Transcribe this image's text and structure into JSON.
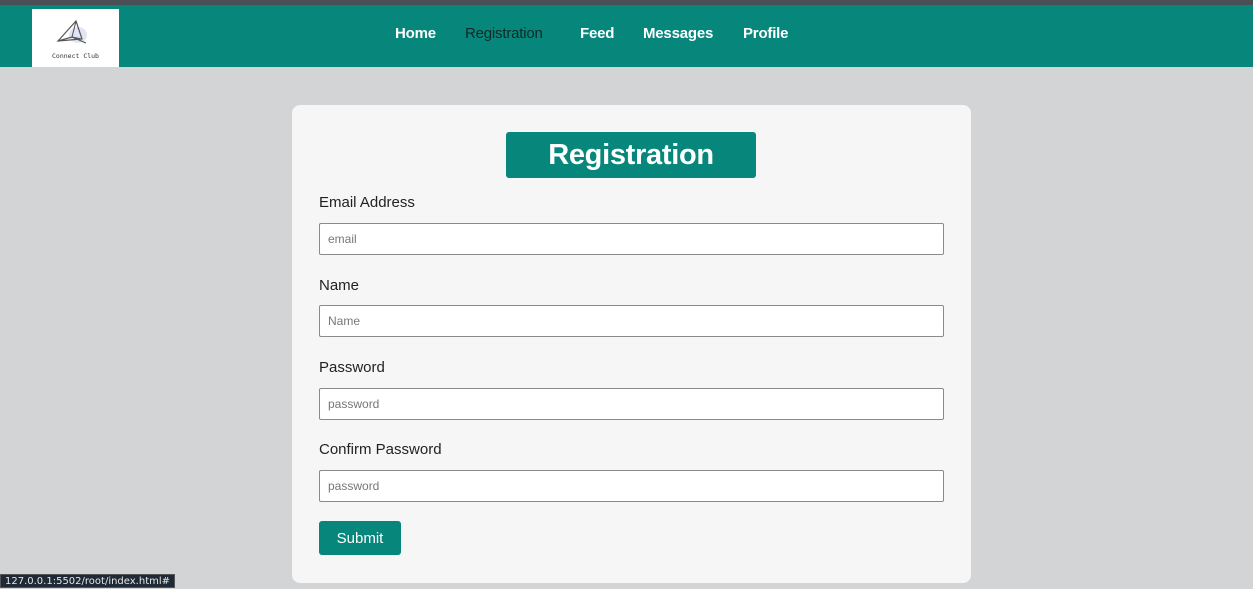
{
  "brand": {
    "logo_text": "Connect Club"
  },
  "nav": {
    "items": [
      {
        "label": "Home"
      },
      {
        "label": "Registration",
        "active": true
      },
      {
        "label": "Feed"
      },
      {
        "label": "Messages"
      },
      {
        "label": "Profile"
      }
    ]
  },
  "form": {
    "title": "Registration",
    "fields": [
      {
        "label": "Email Address",
        "placeholder": "email",
        "value": ""
      },
      {
        "label": "Name",
        "placeholder": "Name",
        "value": ""
      },
      {
        "label": "Password",
        "placeholder": "password",
        "value": ""
      },
      {
        "label": "Confirm Password",
        "placeholder": "password",
        "value": ""
      }
    ],
    "submit_label": "Submit"
  },
  "status_url": "127.0.0.1:5502/root/index.html#",
  "colors": {
    "accent": "#07877c",
    "background": "#d3d4d6",
    "card": "#f6f6f6"
  }
}
